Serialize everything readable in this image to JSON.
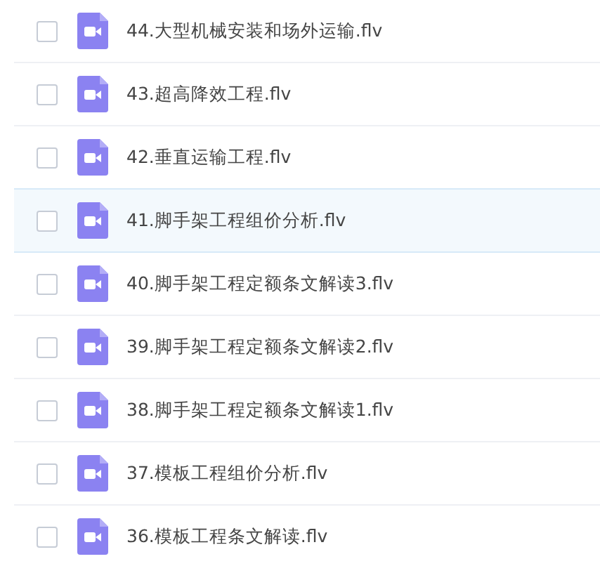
{
  "files": [
    {
      "name": "44.大型机械安装和场外运输.flv",
      "checked": false,
      "selected": false
    },
    {
      "name": "43.超高降效工程.flv",
      "checked": false,
      "selected": false
    },
    {
      "name": "42.垂直运输工程.flv",
      "checked": false,
      "selected": false
    },
    {
      "name": "41.脚手架工程组价分析.flv",
      "checked": false,
      "selected": true
    },
    {
      "name": "40.脚手架工程定额条文解读3.flv",
      "checked": false,
      "selected": false
    },
    {
      "name": "39.脚手架工程定额条文解读2.flv",
      "checked": false,
      "selected": false
    },
    {
      "name": "38.脚手架工程定额条文解读1.flv",
      "checked": false,
      "selected": false
    },
    {
      "name": "37.模板工程组价分析.flv",
      "checked": false,
      "selected": false
    },
    {
      "name": "36.模板工程条文解读.flv",
      "checked": false,
      "selected": false
    }
  ]
}
